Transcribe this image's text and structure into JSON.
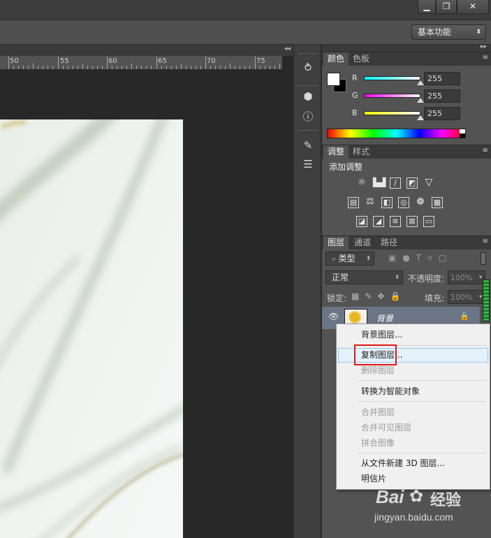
{
  "window": {
    "minimize_glyph": "▁",
    "maximize_glyph": "❐",
    "close_glyph": "✕"
  },
  "options_bar": {
    "workspace": "基本功能",
    "workspace_arrow": "⬍"
  },
  "ruler": {
    "labels": [
      "50",
      "55",
      "60",
      "65",
      "70",
      "75"
    ]
  },
  "strip_icons": [
    "history-icon",
    "3d-icon",
    "info-icon",
    "brush-icon",
    "properties-icon"
  ],
  "color_panel": {
    "tabs": [
      "颜色",
      "色板"
    ],
    "channels": [
      {
        "label": "R",
        "value": "255",
        "color": "#3ee6e6"
      },
      {
        "label": "G",
        "value": "255",
        "color": "#e23ae2"
      },
      {
        "label": "B",
        "value": "255",
        "color": "#e8e83a"
      }
    ]
  },
  "adjustments_panel": {
    "tabs": [
      "调整",
      "样式"
    ],
    "title": "添加调整",
    "icons_row1": [
      "brightness-icon",
      "levels-icon",
      "curves-icon",
      "exposure-icon",
      "vibrance-icon"
    ],
    "icons_row2": [
      "hue-saturation-icon",
      "color-balance-icon",
      "black-white-icon",
      "photo-filter-icon",
      "channel-mixer-icon",
      "color-lookup-icon"
    ],
    "icons_row3": [
      "invert-icon",
      "posterize-icon",
      "threshold-icon",
      "gradient-map-icon",
      "selective-color-icon"
    ]
  },
  "layers_panel": {
    "tabs": [
      "图层",
      "通道",
      "路径"
    ],
    "filter_label": "类型",
    "blend_mode": "正常",
    "opacity_label": "不透明度:",
    "opacity_value": "100%",
    "lock_label": "锁定:",
    "fill_label": "填充:",
    "fill_value": "100%",
    "layer_name": "背景"
  },
  "context_menu": {
    "items": [
      {
        "label": "背景图层...",
        "state": "enabled"
      },
      {
        "label": "复制图层...",
        "state": "hover"
      },
      {
        "label": "删除图层",
        "state": "disabled"
      },
      {
        "label": "转换为智能对象",
        "state": "enabled"
      },
      {
        "label": "合并图层",
        "state": "disabled"
      },
      {
        "label": "合并可见图层",
        "state": "disabled"
      },
      {
        "label": "拼合图像",
        "state": "disabled"
      },
      {
        "label": "从文件新建 3D 图层...",
        "state": "enabled"
      },
      {
        "label": "明信片",
        "state": "enabled"
      }
    ]
  },
  "watermark": {
    "brand": "Bai",
    "brand2": "经验",
    "url": "jingyan.baidu.com"
  }
}
